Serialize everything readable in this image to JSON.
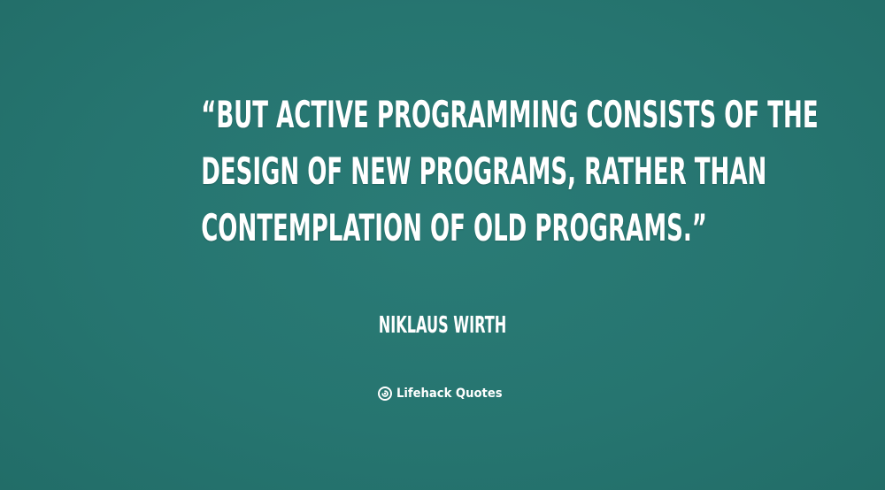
{
  "quote": {
    "lines": [
      "“BUT ACTIVE PROGRAMMING CONSISTS OF THE",
      "DESIGN OF NEW PROGRAMS, RATHER THAN",
      "CONTEMPLATION OF OLD PROGRAMS.”"
    ]
  },
  "author": "NIKLAUS WIRTH",
  "brand": {
    "name": "Lifehack Quotes",
    "icon": "lifehack-logo-icon"
  },
  "colors": {
    "background": "#267570",
    "text": "#ffffff"
  }
}
